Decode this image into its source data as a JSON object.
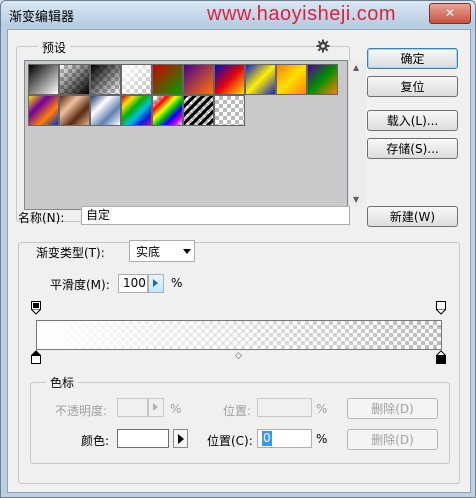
{
  "window": {
    "title": "渐变编辑器",
    "watermark": "www.haoyisheji.com",
    "close_label": "✕"
  },
  "presets": {
    "label": "预设",
    "gear_icon": "gear-icon",
    "swatches": [
      "black-white",
      "transparent-black",
      "black-transparent",
      "white-transparent",
      "red-green",
      "violet-orange",
      "blue-red-yellow",
      "blue-yellow-blue",
      "orange-yellow-orange",
      "violet-green-orange",
      "yellow-violet-orange-blue",
      "copper",
      "chrome",
      "spectrum",
      "transparent-rainbow",
      "transparent-stripes",
      "transparent"
    ]
  },
  "buttons": {
    "ok": "确定",
    "reset": "复位",
    "load": "载入(L)...",
    "save": "存储(S)...",
    "new": "新建(W)"
  },
  "name": {
    "label": "名称(N):",
    "value": "自定"
  },
  "gradient": {
    "type_label": "渐变类型(T):",
    "type_value": "实底",
    "smoothness_label": "平滑度(M):",
    "smoothness_value": "100",
    "smoothness_unit": "%"
  },
  "stops": {
    "label": "色标",
    "opacity_label": "不透明度:",
    "opacity_value": "",
    "opacity_unit": "%",
    "position_label_top": "位置:",
    "position_value_top": "",
    "position_unit_top": "%",
    "delete_label_top": "删除(D)",
    "color_label": "颜色:",
    "position_label": "位置(C):",
    "position_value": "0",
    "position_unit": "%",
    "delete_label": "删除(D)"
  }
}
